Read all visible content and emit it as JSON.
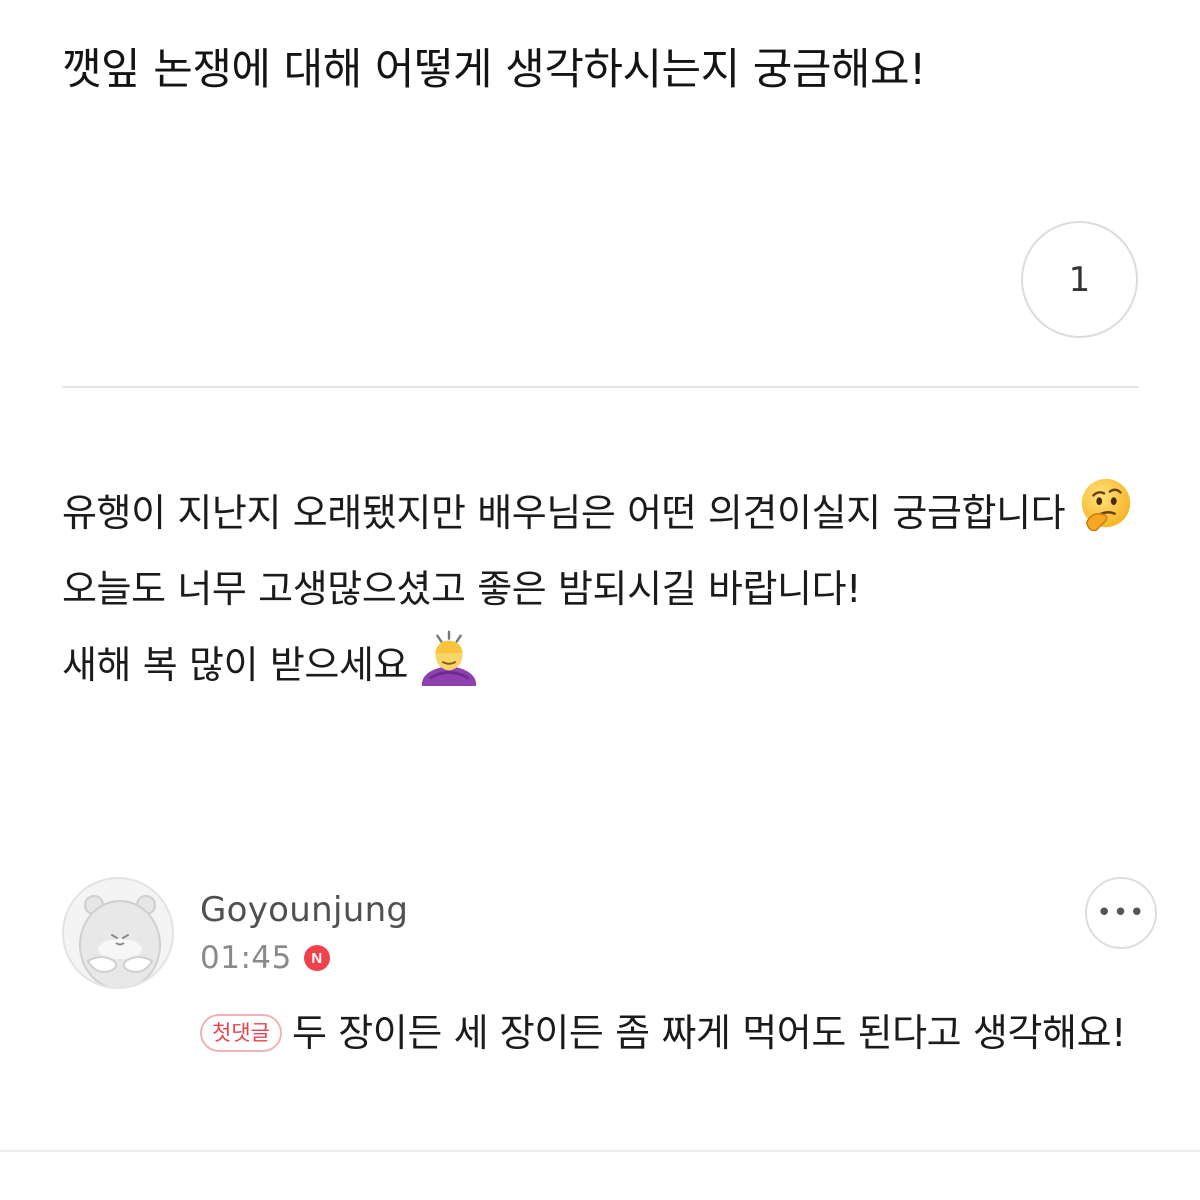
{
  "question": {
    "title": "깻잎 논쟁에 대해 어떻게 생각하시는지 궁금해요!",
    "count": "1"
  },
  "post": {
    "line1": "유행이 지난지 오래됐지만 배우님은 어떤 의견이실지 궁금합니다",
    "line1_emoji": "thinking-face-emoji",
    "line2": "오늘도 너무 고생많으셨고 좋은 밤되시길 바랍니다!",
    "line3": "새해 복 많이 받으세요",
    "line3_emoji": "person-bowing-emoji"
  },
  "comment": {
    "author": "Goyounjung",
    "time": "01:45",
    "new_badge": "N",
    "first_comment_badge": "첫댓글",
    "text": "두 장이든 세 장이든 좀 짜게 먹어도 된다고 생각해요!",
    "more_label": "•••"
  },
  "colors": {
    "accent_red": "#f0424b",
    "divider": "#e6e6e6"
  }
}
